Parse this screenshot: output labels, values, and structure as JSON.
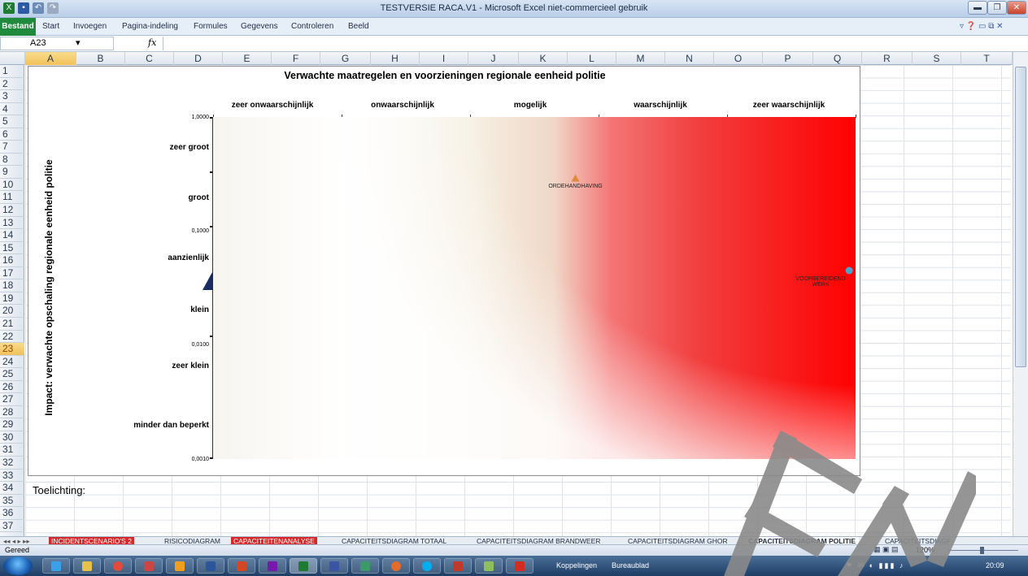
{
  "app": {
    "window_title": "TESTVERSIE RACA.V1  -  Microsoft Excel niet-commercieel gebruik"
  },
  "ribbon": {
    "file_tab": "Bestand",
    "tabs": [
      "Start",
      "Invoegen",
      "Pagina-indeling",
      "Formules",
      "Gegevens",
      "Controleren",
      "Beeld"
    ]
  },
  "formula_bar": {
    "name_box": "A23",
    "fx": "fx"
  },
  "columns": [
    "A",
    "B",
    "C",
    "D",
    "E",
    "F",
    "G",
    "H",
    "I",
    "J",
    "K",
    "L",
    "M",
    "N",
    "O",
    "P",
    "Q",
    "R",
    "S",
    "T"
  ],
  "selected_column": "A",
  "rows": [
    "1",
    "2",
    "3",
    "4",
    "5",
    "6",
    "7",
    "8",
    "9",
    "10",
    "11",
    "12",
    "13",
    "14",
    "15",
    "16",
    "17",
    "18",
    "19",
    "20",
    "21",
    "22",
    "23",
    "24",
    "25",
    "26",
    "27",
    "28",
    "29",
    "30",
    "31",
    "32",
    "33",
    "34",
    "35",
    "36",
    "37"
  ],
  "selected_row": "23",
  "chart_data": {
    "type": "scatter",
    "title": "Verwachte maatregelen en voorzieningen regionale eenheid politie",
    "ylabel": "Impact: verwachte opschaling regionale eenheid politie",
    "x_categories": [
      "zeer onwaarschijnlijk",
      "onwaarschijnlijk",
      "mogelijk",
      "waarschijnlijk",
      "zeer waarschijnlijk"
    ],
    "y_categories": [
      "zeer groot",
      "groot",
      "aanzienlijk",
      "klein",
      "zeer klein",
      "minder dan beperkt"
    ],
    "y_ticks": [
      "1,0000",
      "0,1000",
      "0,0100",
      "0,0010"
    ],
    "y_scale": "log",
    "ylim": [
      0.001,
      1
    ],
    "xlim": [
      0,
      5
    ],
    "series": [
      {
        "name": "ORDEHANDHAVING",
        "x": 2.82,
        "y": 0.29,
        "marker": "triangle",
        "color": "#e08a3c"
      },
      {
        "name": "VOORBEREIDEND WERK",
        "x": 4.95,
        "y": 0.045,
        "marker": "circle",
        "color": "#4aa3c8"
      }
    ]
  },
  "note_label": "Toelichting:",
  "sheet_tabs": [
    {
      "label": "INCIDENTSCENARIO'S 2",
      "style": "red"
    },
    {
      "label": "RISICODIAGRAM",
      "style": "normal"
    },
    {
      "label": "CAPACITEITENANALYSE",
      "style": "red"
    },
    {
      "label": "CAPACITEITSDIAGRAM TOTAAL",
      "style": "normal"
    },
    {
      "label": "CAPACITEITSDIAGRAM BRANDWEER",
      "style": "normal"
    },
    {
      "label": "CAPACITEITSDIAGRAM GHOR",
      "style": "normal"
    },
    {
      "label": "CAPACITEITSDIAGRAM POLITIE",
      "style": "active"
    },
    {
      "label": "CAPACITEITSDIAGF",
      "style": "normal"
    }
  ],
  "status": {
    "ready": "Gereed",
    "zoom": "120%"
  },
  "taskbar": {
    "links_label": "Koppelingen",
    "desktop_label": "Bureaublad",
    "clock": "20:09"
  },
  "colors": {
    "excel_green": "#1f8a3b",
    "chart_red": "#ff0000",
    "chart_tan": "#ccbd9e",
    "marker_navy": "#1b2a63"
  }
}
